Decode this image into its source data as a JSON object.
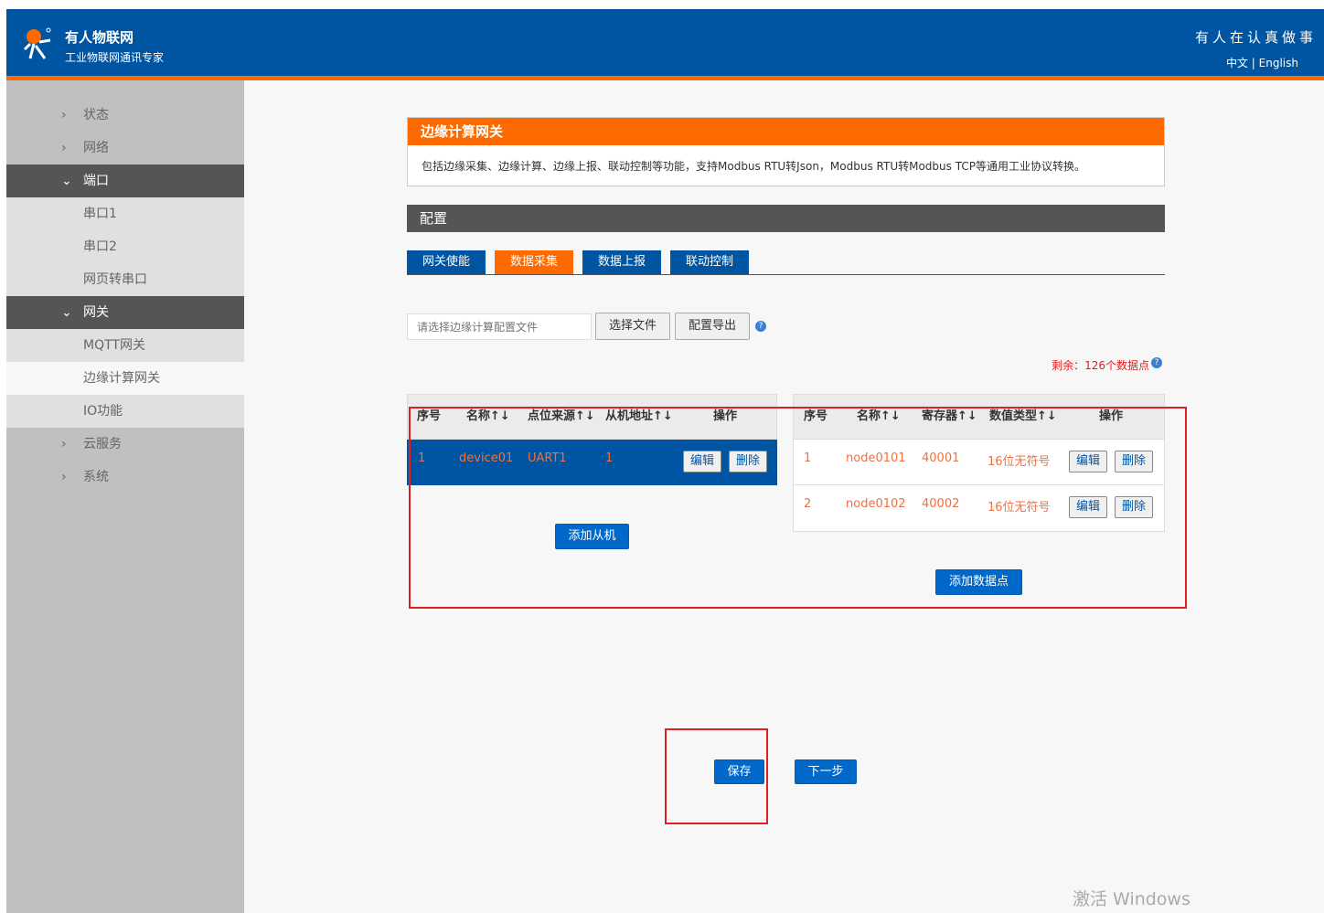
{
  "header": {
    "brand": "有人物联网",
    "slogan": "工业物联网通讯专家",
    "motto": "有人在认真做事",
    "lang_zh": "中文",
    "lang_sep": "|",
    "lang_en": "English"
  },
  "sidebar": {
    "items": [
      {
        "label": "状态",
        "type": "collapsed"
      },
      {
        "label": "网络",
        "type": "collapsed"
      },
      {
        "label": "端口",
        "type": "open"
      },
      {
        "label": "串口1",
        "type": "sub"
      },
      {
        "label": "串口2",
        "type": "sub"
      },
      {
        "label": "网页转串口",
        "type": "sub"
      },
      {
        "label": "网关",
        "type": "open"
      },
      {
        "label": "MQTT网关",
        "type": "sub"
      },
      {
        "label": "边缘计算网关",
        "type": "active"
      },
      {
        "label": "IO功能",
        "type": "sub"
      },
      {
        "label": "云服务",
        "type": "collapsed"
      },
      {
        "label": "系统",
        "type": "collapsed"
      }
    ]
  },
  "panel": {
    "title": "边缘计算网关",
    "desc": "包括边缘采集、边缘计算、边缘上报、联动控制等功能，支持Modbus RTU转Json，Modbus RTU转Modbus TCP等通用工业协议转换。"
  },
  "config": {
    "title": "配置",
    "tabs": [
      "网关使能",
      "数据采集",
      "数据上报",
      "联动控制"
    ],
    "active_tab": 1,
    "file_placeholder": "请选择边缘计算配置文件",
    "choose_file": "选择文件",
    "export": "配置导出",
    "remaining": "剩余：126个数据点"
  },
  "slaves": {
    "headers": [
      "序号",
      "名称↑↓",
      "点位来源↑↓",
      "从机地址↑↓",
      "操作"
    ],
    "rows": [
      {
        "no": "1",
        "name": "device01",
        "source": "UART1",
        "addr": "1"
      }
    ],
    "add": "添加从机"
  },
  "points": {
    "headers": [
      "序号",
      "名称↑↓",
      "寄存器↑↓",
      "数值类型↑↓",
      "操作"
    ],
    "rows": [
      {
        "no": "1",
        "name": "node0101",
        "reg": "40001",
        "type": "16位无符号"
      },
      {
        "no": "2",
        "name": "node0102",
        "reg": "40002",
        "type": "16位无符号"
      }
    ],
    "add": "添加数据点"
  },
  "actions": {
    "edit": "编辑",
    "delete": "删除",
    "save": "保存",
    "next": "下一步"
  },
  "watermark": "激活 Windows",
  "colors": {
    "header": "#0055a2",
    "accent": "#ff6a00"
  }
}
